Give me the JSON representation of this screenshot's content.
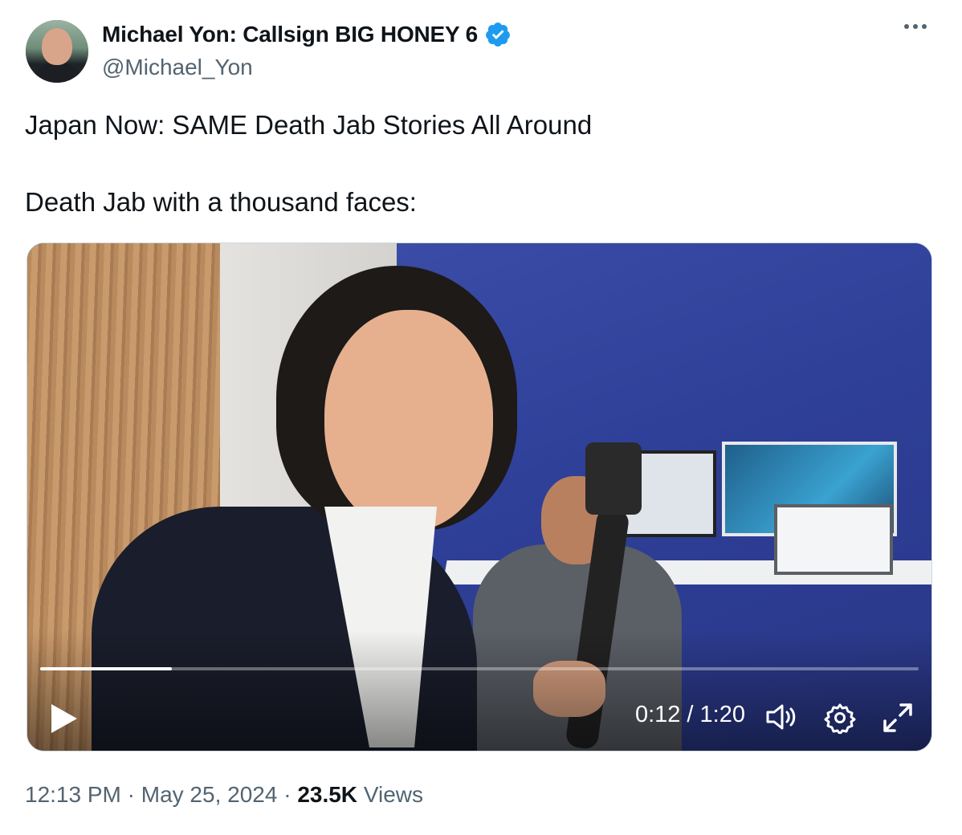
{
  "author": {
    "name": "Michael Yon: Callsign BIG HONEY 6",
    "handle": "@Michael_Yon",
    "verified_color": "#1d9bf0"
  },
  "tweet": {
    "line1": "Japan Now: SAME Death Jab Stories All Around",
    "line2": "Death Jab with a thousand faces:"
  },
  "video": {
    "current_time": "0:12",
    "duration": "1:20",
    "time_display": "0:12 / 1:20",
    "progress_fraction": 0.15,
    "icons": [
      "play-icon",
      "volume-icon",
      "settings-gear-icon",
      "fullscreen-icon"
    ]
  },
  "meta": {
    "time": "12:13 PM",
    "sep": "·",
    "date": "May 25, 2024",
    "views_count": "23.5K",
    "views_label": "Views"
  }
}
